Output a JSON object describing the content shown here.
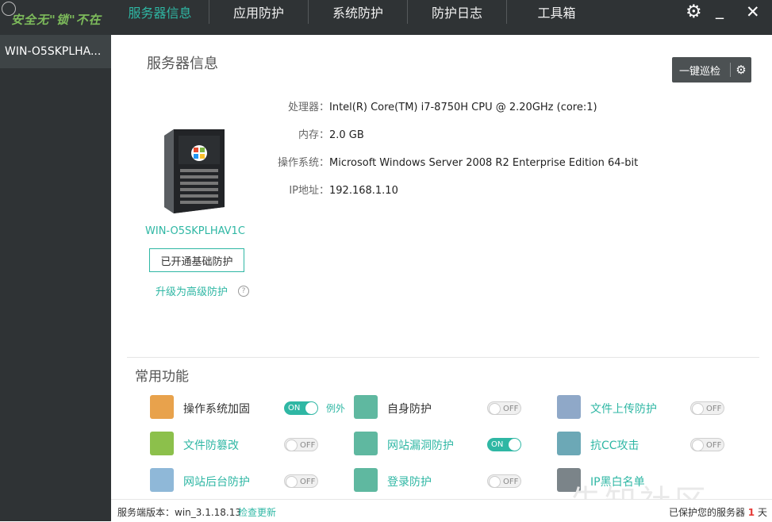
{
  "app": {
    "logo_text": "安全无\"锁\"不在"
  },
  "nav": {
    "items": [
      {
        "label": "服务器信息",
        "active": true
      },
      {
        "label": "应用防护"
      },
      {
        "label": "系统防护"
      },
      {
        "label": "防护日志"
      },
      {
        "label": "工具箱"
      }
    ],
    "settings_icon": "gear-icon",
    "minimize_icon": "minimize-icon",
    "close_icon": "close-icon"
  },
  "sidebar": {
    "items": [
      {
        "label": "WIN-O5SKPLHA..."
      }
    ]
  },
  "panel": {
    "title": "服务器信息",
    "scan_button": "一键巡检",
    "hostname": "WIN-O5SKPLHAV1C",
    "basic_protection_button": "已开通基础防护",
    "upgrade_link": "升级为高级防护",
    "help_icon": "?",
    "info": [
      {
        "key": "处理器：",
        "value": "Intel(R) Core(TM) i7-8750H CPU @ 2.20GHz (core:1)"
      },
      {
        "key": "内存：",
        "value": "2.0 GB"
      },
      {
        "key": "操作系统：",
        "value": "Microsoft Windows Server 2008 R2 Enterprise Edition 64-bit"
      },
      {
        "key": "IP地址：",
        "value": "192.168.1.10"
      }
    ]
  },
  "features": {
    "title": "常用功能",
    "items": [
      {
        "label": "操作系统加固",
        "state": "ON",
        "extra": "例外",
        "icon": "firewall-icon",
        "color": "#e8a24c"
      },
      {
        "label": "自身防护",
        "state": "OFF",
        "icon": "shield-icon",
        "color": "#5fb8a0"
      },
      {
        "label": "文件上传防护",
        "state": "OFF",
        "icon": "upload-icon",
        "color": "#8fa8c8"
      },
      {
        "label": "文件防篡改",
        "state": "OFF",
        "icon": "document-edit-icon",
        "color": "#8cc04b"
      },
      {
        "label": "网站漏洞防护",
        "state": "ON",
        "icon": "puzzle-icon",
        "color": "#5fb8a0"
      },
      {
        "label": "抗CC攻击",
        "state": "OFF",
        "icon": "cc-icon",
        "color": "#6ca8b6"
      },
      {
        "label": "网站后台防护",
        "state": "OFF",
        "icon": "monitor-icon",
        "color": "#8fb8d8"
      },
      {
        "label": "登录防护",
        "state": "OFF",
        "icon": "shield-login-icon",
        "color": "#5fb8a0"
      },
      {
        "label": "IP黑白名单",
        "state": "",
        "icon": "list-icon",
        "color": "#7b8489"
      }
    ]
  },
  "status": {
    "version_text": "服务端版本：win_3.1.18.13",
    "check_update": "检查更新",
    "protected_prefix": "已保护您的服务器",
    "protected_days": "1",
    "protected_suffix": "天"
  },
  "watermark": "先知社区"
}
